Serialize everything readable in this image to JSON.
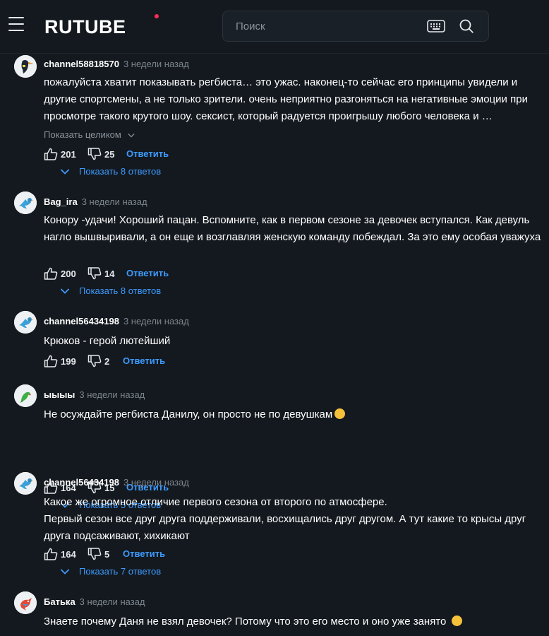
{
  "header": {
    "logo": "RUTUBE",
    "search_placeholder": "Поиск"
  },
  "labels": {
    "reply": "Ответить",
    "show_full": "Показать целиком"
  },
  "comments": [
    {
      "author": "channel58818570",
      "time": "3 недели назад",
      "text": "пожалуйста хватит показывать регбиста… это ужас. наконец-то сейчас его принципы увидели и другие спортсмены, а не только зрители. очень неприятно разгоняться на негативные эмоции при просмотре такого крутого шоу. сексист, который радуется проигрышу любого человека и …",
      "likes": "201",
      "dislikes": "25",
      "replies": "Показать 8 ответов"
    },
    {
      "author": "Bag_ira",
      "time": "3 недели назад",
      "text": "Конору -удачи! Хороший пацан. Вспомните, как в первом сезоне за девочек вступался. Как девуль нагло вышвыривали, а он еще и возглавляя женскую команду побеждал. За это ему особая уважуха",
      "likes": "200",
      "dislikes": "14",
      "replies": "Показать 8 ответов"
    },
    {
      "author": "channel56434198",
      "time": "3 недели назад",
      "text": "Крюков - герой лютейший",
      "likes": "199",
      "dislikes": "2"
    },
    {
      "author": "ыыыы",
      "time": "3 недели назад",
      "text": "Не осуждайте регбиста Данилу, он просто не по девушкам",
      "likes": "164",
      "dislikes": "15",
      "replies": "Показать 5 ответов"
    },
    {
      "author": "channel56434198",
      "time": "3 недели назад",
      "text_line1": "Какое же огромное отличие первого сезона от второго по атмосфере.",
      "text_line2": "Первый сезон все друг друга поддерживали, восхищались друг другом. А тут какие то крысы друг друга подсаживают, хихикают",
      "likes": "164",
      "dislikes": "5",
      "replies": "Показать 7 ответов"
    },
    {
      "author": "Батька",
      "time": "3 недели назад",
      "text": "Знаете почему Даня не взял девочек? Потому что это его место и оно уже занято"
    }
  ]
}
